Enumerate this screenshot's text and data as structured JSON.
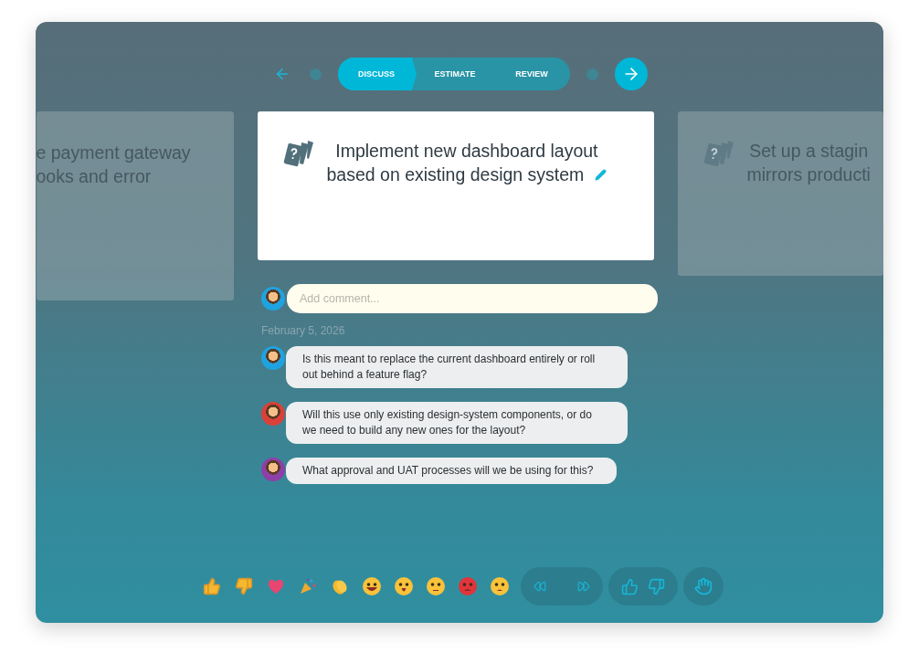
{
  "stepper": {
    "steps": [
      {
        "label": "DISCUSS",
        "selected": true
      },
      {
        "label": "ESTIMATE",
        "selected": false
      },
      {
        "label": "REVIEW",
        "selected": false
      }
    ]
  },
  "cards": [
    {
      "kind": "side",
      "lines": [
        "e payment gateway",
        "ooks and error"
      ]
    },
    {
      "kind": "main",
      "lines": [
        "Implement new dashboard layout",
        "based on existing design system"
      ]
    },
    {
      "kind": "side-icon",
      "lines": [
        "Set up a stagin",
        "mirrors producti"
      ]
    }
  ],
  "comment_field": {
    "placeholder": "Add comment..."
  },
  "date": "February 5, 2026",
  "comments": [
    {
      "text": "Is this meant to replace the current dashboard entirely or roll out behind a feature flag?",
      "color": "#1fa3e0"
    },
    {
      "text": "Will this use only existing design-system components, or do we need to build any new ones for the layout?",
      "color": "#d9413a"
    },
    {
      "text": "What approval and UAT processes will we be using for this?",
      "color": "#8e3fa8"
    }
  ]
}
